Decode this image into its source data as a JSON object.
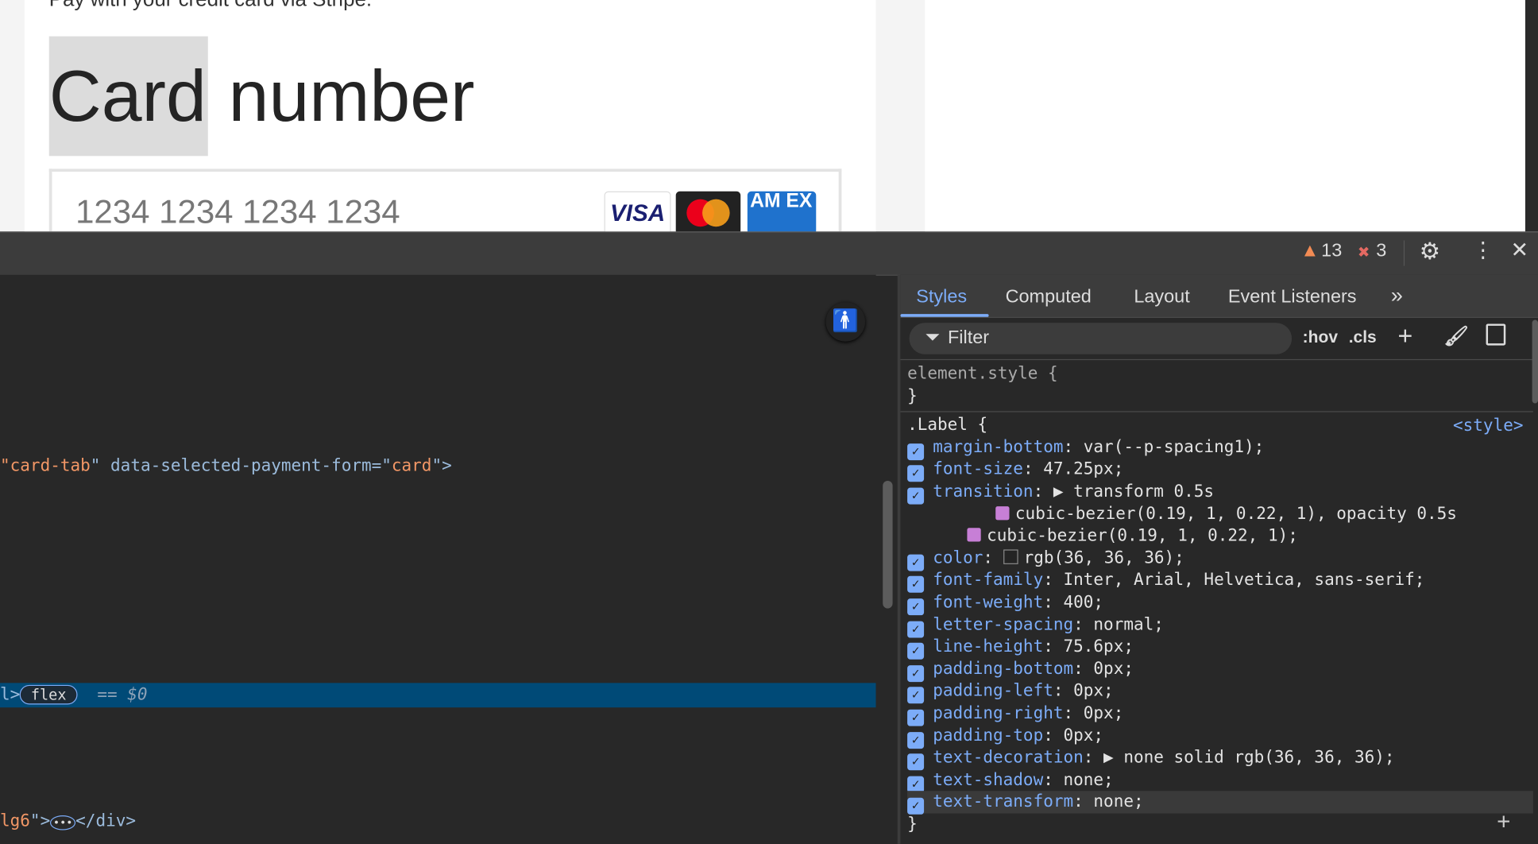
{
  "page": {
    "pay_text": "Pay with your credit card via Stripe.",
    "label_highlight": "Card",
    "label_rest": " number",
    "card_placeholder": "1234 1234 1234 1234",
    "brands": {
      "visa": "VISA",
      "amex": "AM EX"
    }
  },
  "toolbar": {
    "warnings": "13",
    "errors": "3"
  },
  "elements": {
    "line1_prefix": "\"",
    "line1_val1": "card-tab",
    "line1_mid": "\" data-selected-payment-form=\"",
    "line1_val2": "card",
    "line1_end": "\">",
    "selected_prefix": "l>",
    "selected_badge": "flex",
    "selected_eq": "==",
    "selected_ref": "$0",
    "line3_val": "lg6",
    "line3_end": "\">",
    "line3_close": "</div>"
  },
  "styles": {
    "tabs": [
      "Styles",
      "Computed",
      "Layout",
      "Event Listeners"
    ],
    "filter_placeholder": "Filter",
    "hov": ":hov",
    "cls": ".cls",
    "element_style_open": "element.style {",
    "close_brace": "}",
    "rule_selector": ".Label {",
    "rule_source": "<style>",
    "declarations": [
      {
        "prop": "margin-bottom",
        "value": "var(--p-spacing1);"
      },
      {
        "prop": "font-size",
        "value": "47.25px;"
      },
      {
        "prop": "transition",
        "value": "▶ transform 0.5s"
      },
      {
        "prop": "",
        "value": "cubic-bezier(0.19, 1, 0.22, 1), opacity 0.5s"
      },
      {
        "prop": "",
        "value": "cubic-bezier(0.19, 1, 0.22, 1);"
      },
      {
        "prop": "color",
        "value": "rgb(36, 36, 36);"
      },
      {
        "prop": "font-family",
        "value": "Inter, Arial, Helvetica, sans-serif;"
      },
      {
        "prop": "font-weight",
        "value": "400;"
      },
      {
        "prop": "letter-spacing",
        "value": "normal;"
      },
      {
        "prop": "line-height",
        "value": "75.6px;"
      },
      {
        "prop": "padding-bottom",
        "value": "0px;"
      },
      {
        "prop": "padding-left",
        "value": "0px;"
      },
      {
        "prop": "padding-right",
        "value": "0px;"
      },
      {
        "prop": "padding-top",
        "value": "0px;"
      },
      {
        "prop": "text-decoration",
        "value": "▶ none solid rgb(36, 36, 36);"
      },
      {
        "prop": "text-shadow",
        "value": "none;"
      },
      {
        "prop": "text-transform",
        "value": "none;"
      }
    ]
  },
  "colors": {
    "accent": "#7cacf8",
    "selected_row": "#004a77",
    "warning": "#f28b54",
    "error": "#e46962"
  }
}
